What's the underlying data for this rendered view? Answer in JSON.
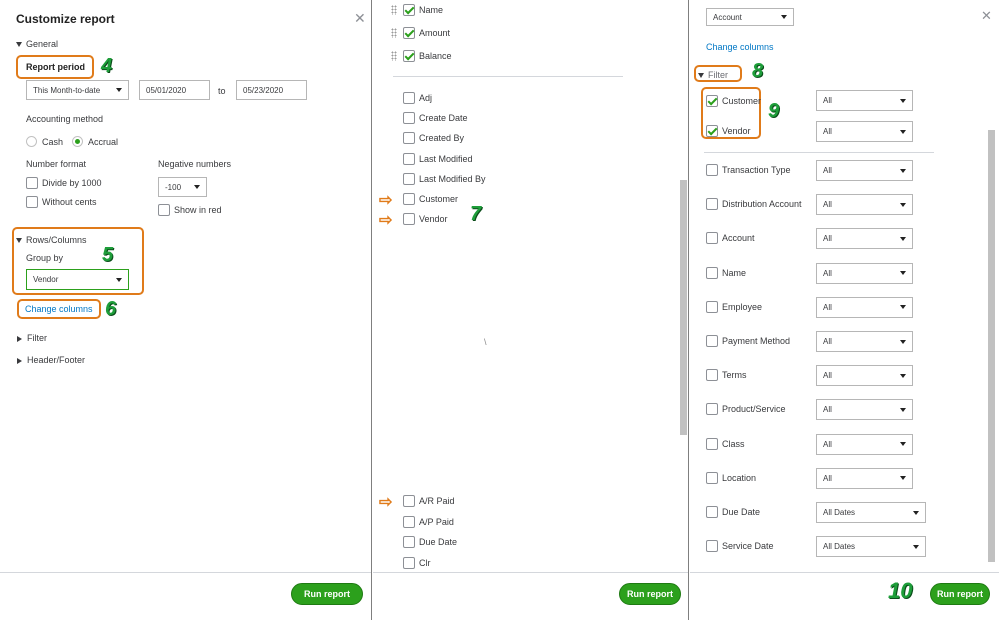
{
  "panel1": {
    "title": "Customize report",
    "general_label": "General",
    "report_period_label": "Report period",
    "period_select": "This Month-to-date",
    "date_from": "05/01/2020",
    "to_label": "to",
    "date_to": "05/23/2020",
    "accounting_method_label": "Accounting method",
    "cash_label": "Cash",
    "accrual_label": "Accrual",
    "number_format_label": "Number format",
    "divide_label": "Divide by 1000",
    "without_cents_label": "Without cents",
    "negative_numbers_label": "Negative numbers",
    "negative_select": "-100",
    "show_red_label": "Show in red",
    "rows_columns_label": "Rows/Columns",
    "group_by_label": "Group by",
    "group_by_value": "Vendor",
    "change_columns_link": "Change columns",
    "filter_label": "Filter",
    "header_footer_label": "Header/Footer",
    "run_report": "Run report",
    "step4": "4",
    "step5": "5",
    "step6": "6"
  },
  "panel2": {
    "checked_columns": [
      "Name",
      "Amount",
      "Balance"
    ],
    "columns": [
      "Adj",
      "Create Date",
      "Created By",
      "Last Modified",
      "Last Modified By",
      "Customer",
      "Vendor"
    ],
    "columns_bottom": [
      "A/R Paid",
      "A/P Paid",
      "Due Date",
      "Clr"
    ],
    "stray_mark": "\\",
    "step7": "7",
    "run_report": "Run report"
  },
  "panel3": {
    "top_select": "Account",
    "change_columns_link": "Change columns",
    "filter_label": "Filter",
    "customer_label": "Customer",
    "customer_value": "All",
    "vendor_label": "Vendor",
    "vendor_value": "All",
    "filters": [
      {
        "label": "Transaction Type",
        "value": "All"
      },
      {
        "label": "Distribution Account",
        "value": "All"
      },
      {
        "label": "Account",
        "value": "All"
      },
      {
        "label": "Name",
        "value": "All"
      },
      {
        "label": "Employee",
        "value": "All"
      },
      {
        "label": "Payment Method",
        "value": "All"
      },
      {
        "label": "Terms",
        "value": "All"
      },
      {
        "label": "Product/Service",
        "value": "All"
      },
      {
        "label": "Class",
        "value": "All"
      },
      {
        "label": "Location",
        "value": "All"
      },
      {
        "label": "Due Date",
        "value": "All Dates"
      },
      {
        "label": "Service Date",
        "value": "All Dates"
      }
    ],
    "step8": "8",
    "step9": "9",
    "step10": "10",
    "run_report": "Run report"
  },
  "colors": {
    "accent": "#2ca01c",
    "highlight": "#e07b1a",
    "link": "#0077c5"
  },
  "icons": [
    "close-icon",
    "check-icon",
    "arrow-right-icon",
    "drag-handle-icon"
  ]
}
